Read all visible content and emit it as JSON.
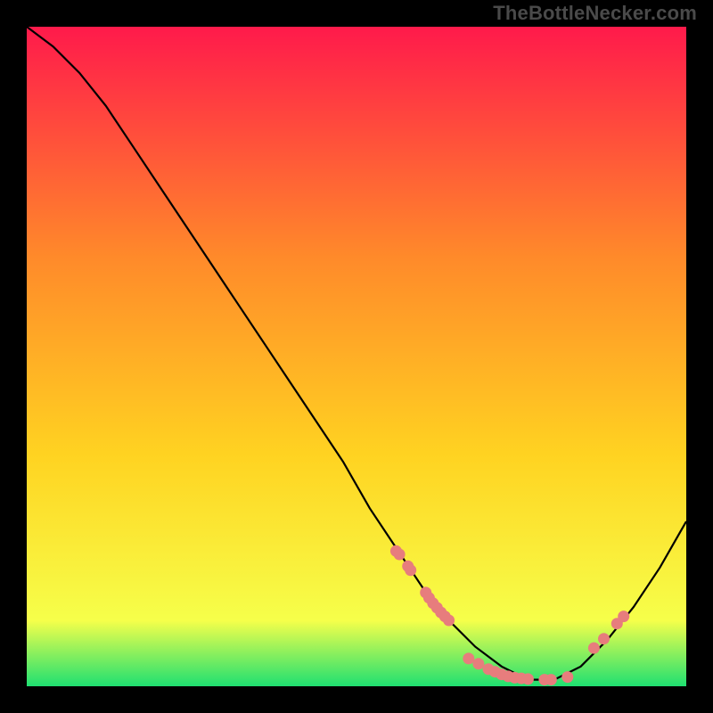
{
  "watermark": "TheBottleNecker.com",
  "chart_data": {
    "type": "line",
    "title": "",
    "xlabel": "",
    "ylabel": "",
    "xlim": [
      0,
      100
    ],
    "ylim": [
      0,
      100
    ],
    "grid": false,
    "legend": false,
    "background_gradient": {
      "top_color": "#ff1a4b",
      "mid_color": "#ffd321",
      "bottom_color": "#1fe071"
    },
    "series": [
      {
        "name": "bottleneck-curve",
        "type": "line",
        "color": "#000000",
        "x": [
          0,
          4,
          8,
          12,
          16,
          20,
          24,
          28,
          32,
          36,
          40,
          44,
          48,
          52,
          56,
          60,
          64,
          68,
          72,
          76,
          80,
          84,
          88,
          92,
          96,
          100
        ],
        "y": [
          100,
          97,
          93,
          88,
          82,
          76,
          70,
          64,
          58,
          52,
          46,
          40,
          34,
          27,
          21,
          15,
          10,
          6,
          3,
          1,
          1,
          3,
          7,
          12,
          18,
          25
        ]
      },
      {
        "name": "markers-left-cluster",
        "type": "scatter",
        "color": "#e77d7d",
        "x": [
          56,
          56.5,
          57.8,
          58.2,
          60.5,
          61.0,
          61.6,
          62.2,
          62.8,
          63.4,
          64.0
        ],
        "y": [
          20.5,
          20.0,
          18.2,
          17.6,
          14.2,
          13.4,
          12.6,
          11.9,
          11.2,
          10.6,
          10.0
        ]
      },
      {
        "name": "markers-valley-cluster",
        "type": "scatter",
        "color": "#e77d7d",
        "x": [
          67.0,
          68.5,
          70.0,
          71.0,
          72.0,
          73.0,
          74.0,
          75.0,
          76.0,
          78.5,
          79.5,
          82.0
        ],
        "y": [
          4.2,
          3.4,
          2.6,
          2.2,
          1.8,
          1.5,
          1.3,
          1.2,
          1.1,
          1.0,
          1.0,
          1.4
        ]
      },
      {
        "name": "markers-right-cluster",
        "type": "scatter",
        "color": "#e77d7d",
        "x": [
          86.0,
          87.5,
          89.5,
          90.5
        ],
        "y": [
          5.8,
          7.2,
          9.5,
          10.6
        ]
      }
    ]
  }
}
